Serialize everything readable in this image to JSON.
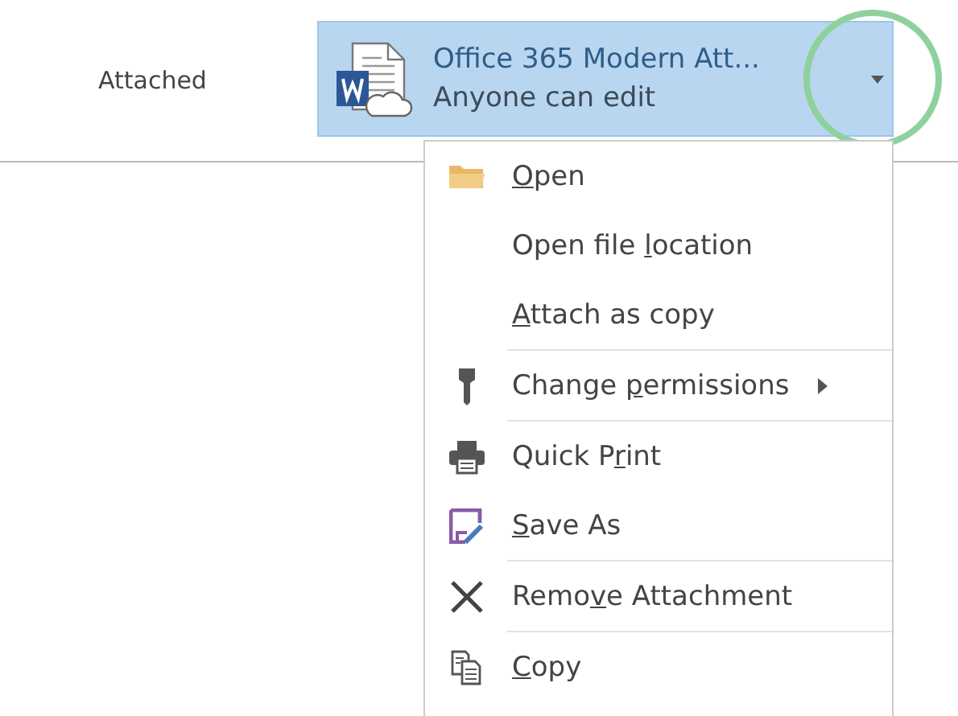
{
  "label": "Attached",
  "attachment": {
    "title": "Office 365 Modern Att...",
    "subtitle": "Anyone can edit",
    "selected": true
  },
  "menu": {
    "groups": [
      {
        "items": [
          {
            "parts": [
              {
                "text": "O",
                "underlined": true
              },
              {
                "text": "pen",
                "underlined": false
              }
            ],
            "has_submenu": false
          },
          {
            "parts": [
              {
                "text": "Open file ",
                "underlined": false
              },
              {
                "text": "l",
                "underlined": true
              },
              {
                "text": "ocation",
                "underlined": false
              }
            ],
            "has_submenu": false
          },
          {
            "parts": [
              {
                "text": "A",
                "underlined": true
              },
              {
                "text": "ttach as copy",
                "underlined": false
              }
            ],
            "has_submenu": false
          }
        ]
      },
      {
        "items": [
          {
            "parts": [
              {
                "text": "Change ",
                "underlined": false
              },
              {
                "text": "p",
                "underlined": true
              },
              {
                "text": "ermissions",
                "underlined": false
              }
            ],
            "has_submenu": true
          }
        ]
      },
      {
        "items": [
          {
            "parts": [
              {
                "text": "Quick P",
                "underlined": false
              },
              {
                "text": "r",
                "underlined": true
              },
              {
                "text": "int",
                "underlined": false
              }
            ],
            "has_submenu": false
          },
          {
            "parts": [
              {
                "text": "S",
                "underlined": true
              },
              {
                "text": "ave As",
                "underlined": false
              }
            ],
            "has_submenu": false
          }
        ]
      },
      {
        "items": [
          {
            "parts": [
              {
                "text": "Remo",
                "underlined": false
              },
              {
                "text": "v",
                "underlined": true
              },
              {
                "text": "e Attachment",
                "underlined": false
              }
            ],
            "has_submenu": false
          }
        ]
      },
      {
        "items": [
          {
            "parts": [
              {
                "text": "C",
                "underlined": true
              },
              {
                "text": "opy",
                "underlined": false
              }
            ],
            "has_submenu": false
          }
        ]
      }
    ]
  }
}
